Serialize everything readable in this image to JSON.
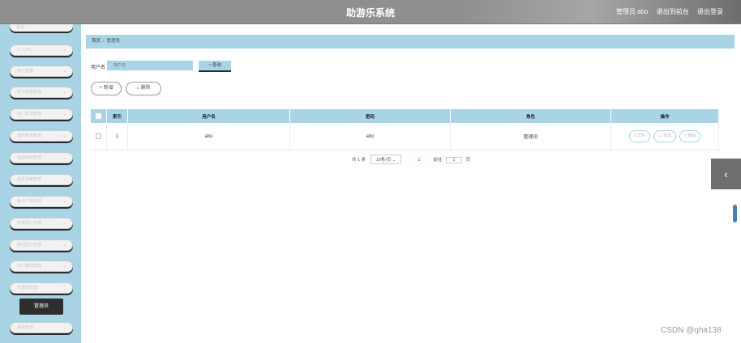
{
  "header": {
    "title": "助游乐系统",
    "admin_label": "管理员 abo",
    "back_label": "退出到前台",
    "logout_label": "退出登录"
  },
  "sidebar": {
    "top_item": "首页",
    "items": [
      {
        "label": "个人中心"
      },
      {
        "label": "用户管理"
      },
      {
        "label": "景点类型管理"
      },
      {
        "label": "热门景点管理"
      },
      {
        "label": "酒店信息管理"
      },
      {
        "label": "酒店房间管理"
      },
      {
        "label": "租赁车辆管理"
      },
      {
        "label": "景点门票管理"
      },
      {
        "label": "车辆预订管理"
      },
      {
        "label": "房间预订管理"
      },
      {
        "label": "出行路线管理"
      },
      {
        "label": "管理员管理"
      }
    ],
    "active_sub": "管理员",
    "bottom_item": "系统管理"
  },
  "breadcrumb": {
    "home": "首页",
    "current": "管理员"
  },
  "search": {
    "label": "用户名",
    "placeholder": "用户名",
    "button": "查询"
  },
  "actions": {
    "add": "新增",
    "delete": "删除"
  },
  "table": {
    "headers": [
      "索引",
      "用户名",
      "密码",
      "角色",
      "操作"
    ],
    "rows": [
      {
        "index": "1",
        "username": "abo",
        "password": "abo",
        "role": "管理员"
      }
    ],
    "row_actions": {
      "detail": "详情",
      "edit": "修改",
      "delete": "删除"
    }
  },
  "pagination": {
    "total": "共 1 条",
    "page_size": "10条/页",
    "current_page": "1",
    "goto_prefix": "前往",
    "goto_value": "1",
    "goto_suffix": "页"
  },
  "watermark": "CSDN @qha138"
}
